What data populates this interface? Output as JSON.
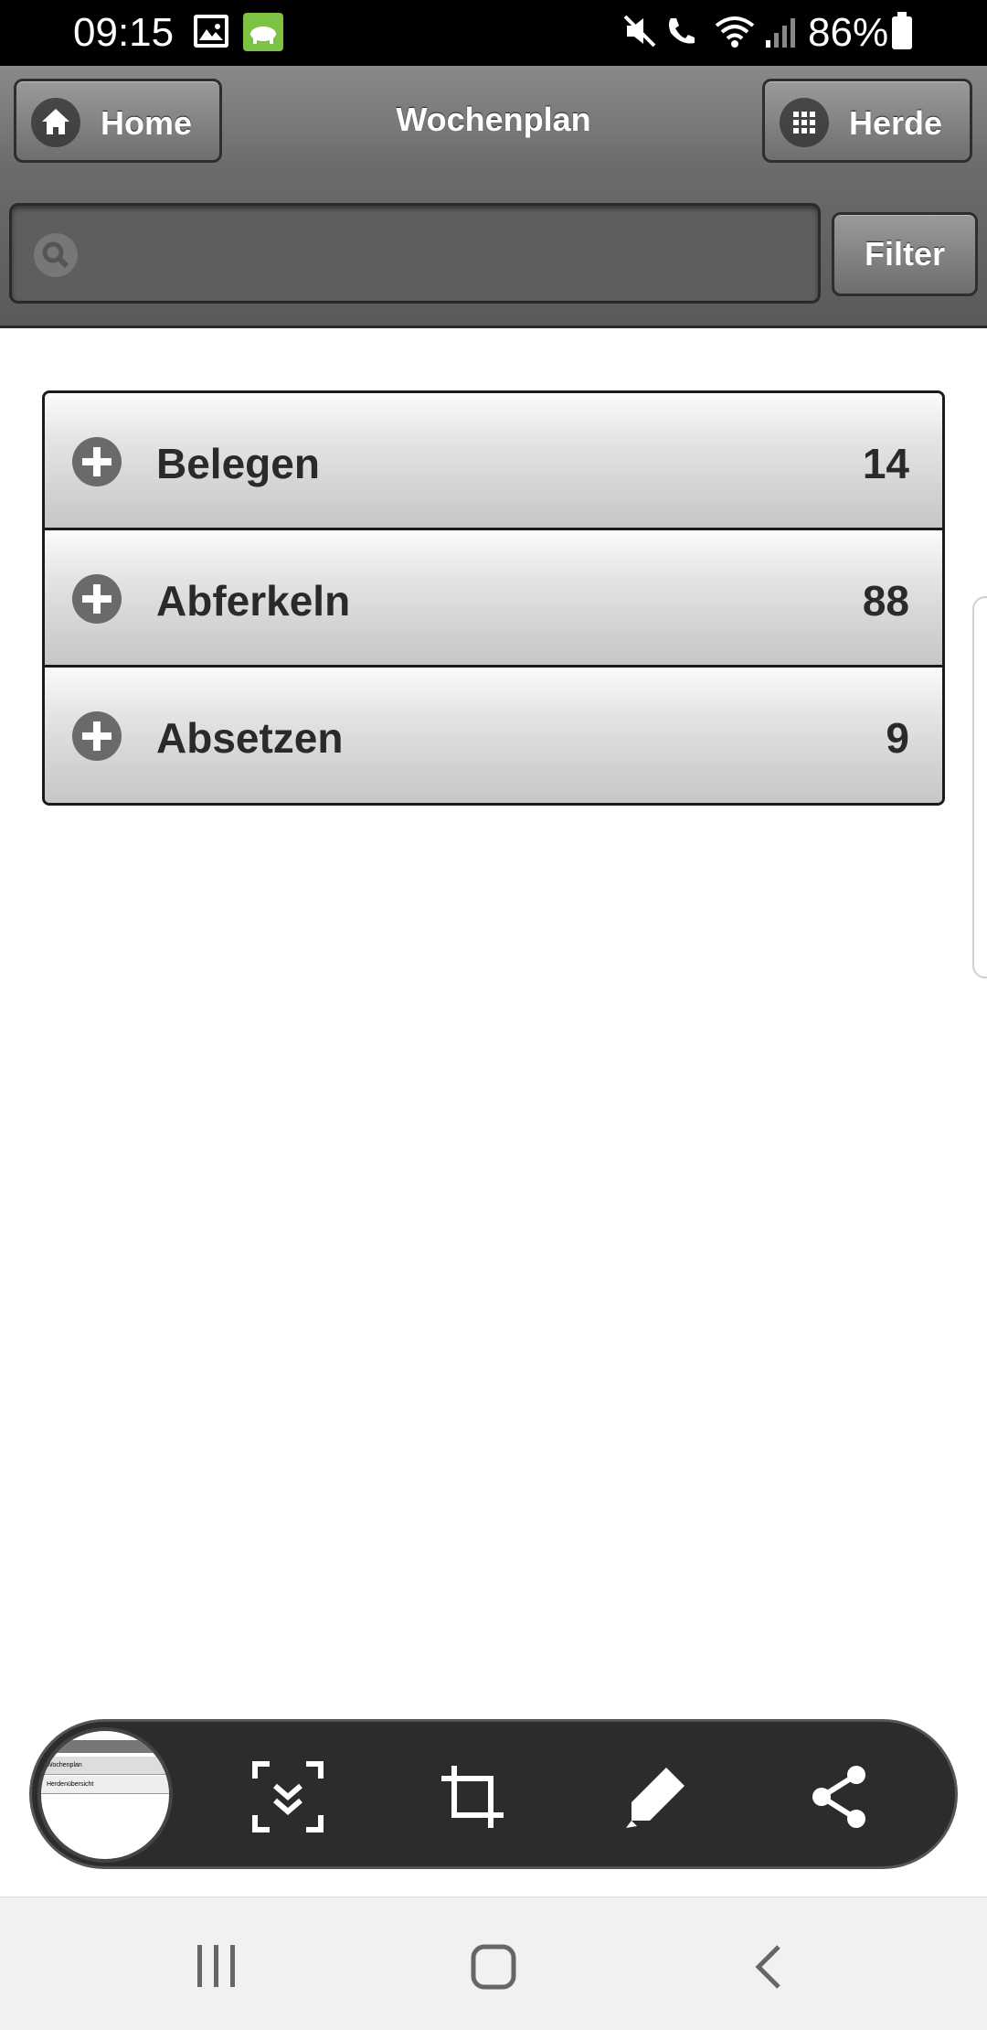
{
  "status_bar": {
    "time": "09:15",
    "battery": "86%"
  },
  "header": {
    "home_label": "Home",
    "title": "Wochenplan",
    "herde_label": "Herde",
    "search_placeholder": "",
    "filter_label": "Filter"
  },
  "list": {
    "items": [
      {
        "label": "Belegen",
        "count": "14"
      },
      {
        "label": "Abferkeln",
        "count": "88"
      },
      {
        "label": "Absetzen",
        "count": "9"
      }
    ]
  },
  "screenshot_toolbar": {
    "thumbnail_rows": [
      "Wochenplan",
      "Herdenübersicht"
    ]
  },
  "colors": {
    "status_bar": "#000000",
    "header": "#6b6b6b",
    "app_icon": "#7dc242",
    "toolbar": "#2c2c2c",
    "nav_bar": "#f1f1f1"
  }
}
